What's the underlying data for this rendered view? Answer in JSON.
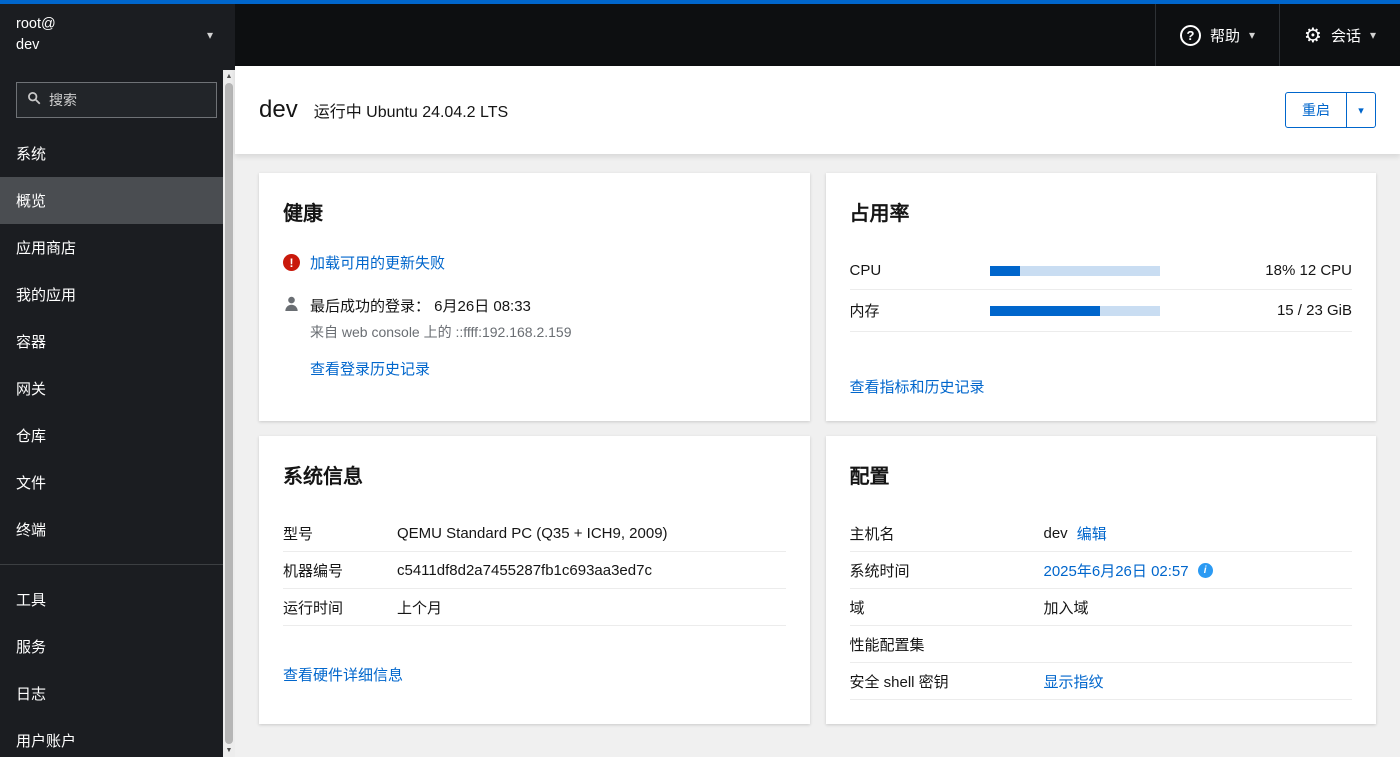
{
  "colors": {
    "accent": "#0066cc",
    "link": "#0066cc",
    "danger": "#c9190b",
    "progress_fill": "#0066cc",
    "progress_track": "#c9ddf2",
    "info_icon": "#2b9af3"
  },
  "icons": {
    "caret_down": "▾",
    "gear": "⚙",
    "help": "?",
    "scroll_up": "▲",
    "scroll_down": "▼",
    "alert": "!",
    "info": "i"
  },
  "masthead": {
    "user": "root@",
    "host": "dev",
    "help": "帮助",
    "session": "会话"
  },
  "sidebar": {
    "search_placeholder": "搜索",
    "items": [
      {
        "label": "系统"
      },
      {
        "label": "概览",
        "selected": true
      },
      {
        "label": "应用商店"
      },
      {
        "label": "我的应用"
      },
      {
        "label": "容器"
      },
      {
        "label": "网关"
      },
      {
        "label": "仓库"
      },
      {
        "label": "文件"
      },
      {
        "label": "终端"
      },
      {
        "label": "工具"
      },
      {
        "label": "服务"
      },
      {
        "label": "日志"
      },
      {
        "label": "用户账户"
      }
    ]
  },
  "header": {
    "hostname": "dev",
    "status": "运行中 Ubuntu 24.04.2 LTS",
    "reboot": "重启"
  },
  "health": {
    "title": "健康",
    "update_error": "加载可用的更新失败",
    "last_login": "最后成功的登录： 6月26日 08:33",
    "login_from": "来自 web console 上的 ::ffff:192.168.2.159",
    "login_history": "查看登录历史记录"
  },
  "usage": {
    "title": "占用率",
    "rows": [
      {
        "label": "CPU",
        "value": "18% 12 CPU",
        "percent": 18
      },
      {
        "label": "内存",
        "value": "15 / 23 GiB",
        "percent": 65
      }
    ],
    "link": "查看指标和历史记录"
  },
  "system_info": {
    "title": "系统信息",
    "rows": [
      {
        "label": "型号",
        "value": "QEMU Standard PC (Q35 + ICH9, 2009)"
      },
      {
        "label": "机器编号",
        "value": "c5411df8d2a7455287fb1c693aa3ed7c"
      },
      {
        "label": "运行时间",
        "value": "上个月"
      }
    ],
    "link": "查看硬件详细信息"
  },
  "config": {
    "title": "配置",
    "rows": [
      {
        "label": "主机名",
        "value": "dev",
        "action": "编辑"
      },
      {
        "label": "系统时间",
        "value": "2025年6月26日 02:57"
      },
      {
        "label": "域",
        "value": "加入域"
      },
      {
        "label": "性能配置集",
        "value": ""
      },
      {
        "label": "安全 shell 密钥",
        "value": "显示指纹"
      }
    ]
  }
}
